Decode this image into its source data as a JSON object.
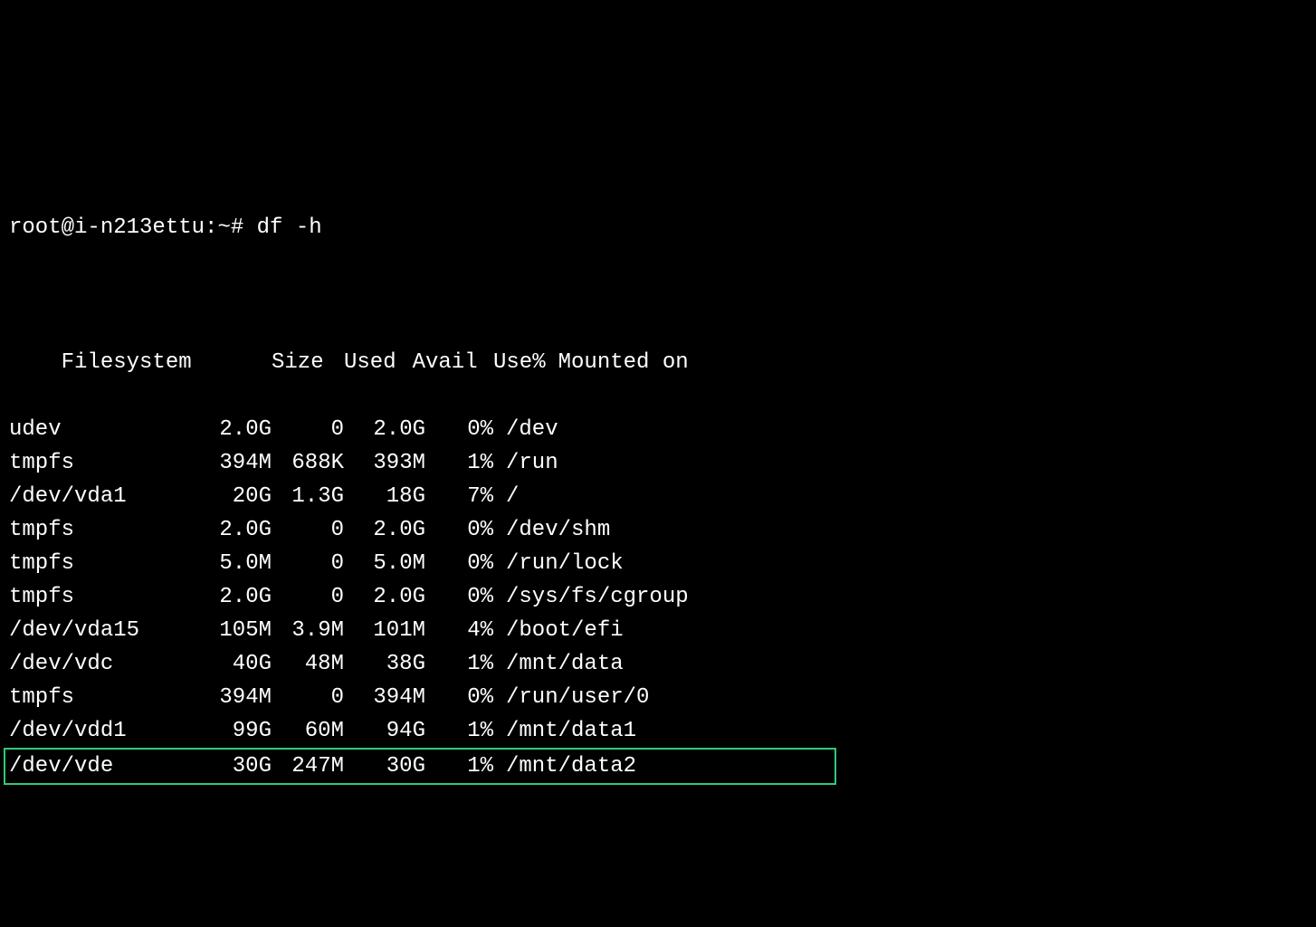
{
  "prompt": "root@i-n213ettu:~#",
  "command": "df -h",
  "headers": {
    "filesystem": "Filesystem",
    "size": "Size",
    "used": "Used",
    "avail": "Avail",
    "usep": "Use%",
    "mount": "Mounted on"
  },
  "rows": [
    {
      "fs": "udev",
      "size": "2.0G",
      "used": "0",
      "avail": "2.0G",
      "usep": "0%",
      "mount": "/dev"
    },
    {
      "fs": "tmpfs",
      "size": "394M",
      "used": "688K",
      "avail": "393M",
      "usep": "1%",
      "mount": "/run"
    },
    {
      "fs": "/dev/vda1",
      "size": "20G",
      "used": "1.3G",
      "avail": "18G",
      "usep": "7%",
      "mount": "/"
    },
    {
      "fs": "tmpfs",
      "size": "2.0G",
      "used": "0",
      "avail": "2.0G",
      "usep": "0%",
      "mount": "/dev/shm"
    },
    {
      "fs": "tmpfs",
      "size": "5.0M",
      "used": "0",
      "avail": "5.0M",
      "usep": "0%",
      "mount": "/run/lock"
    },
    {
      "fs": "tmpfs",
      "size": "2.0G",
      "used": "0",
      "avail": "2.0G",
      "usep": "0%",
      "mount": "/sys/fs/cgroup"
    },
    {
      "fs": "/dev/vda15",
      "size": "105M",
      "used": "3.9M",
      "avail": "101M",
      "usep": "4%",
      "mount": "/boot/efi"
    },
    {
      "fs": "/dev/vdc",
      "size": "40G",
      "used": "48M",
      "avail": "38G",
      "usep": "1%",
      "mount": "/mnt/data"
    },
    {
      "fs": "tmpfs",
      "size": "394M",
      "used": "0",
      "avail": "394M",
      "usep": "0%",
      "mount": "/run/user/0"
    },
    {
      "fs": "/dev/vdd1",
      "size": "99G",
      "used": "60M",
      "avail": "94G",
      "usep": "1%",
      "mount": "/mnt/data1"
    },
    {
      "fs": "/dev/vde",
      "size": "30G",
      "used": "247M",
      "avail": "30G",
      "usep": "1%",
      "mount": "/mnt/data2"
    }
  ],
  "highlighted_index": 10
}
